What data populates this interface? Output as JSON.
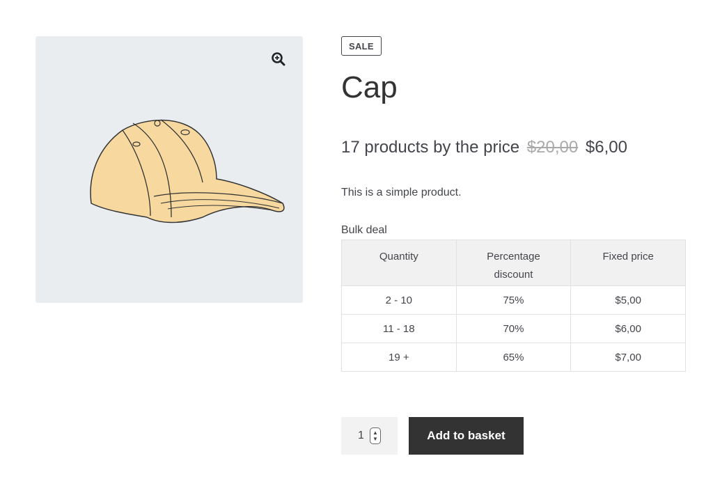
{
  "gallery": {
    "image_alt": "Cap",
    "zoom_icon": "zoom-in-icon"
  },
  "product": {
    "badge": "SALE",
    "title": "Cap",
    "price_prefix": "17 products by the price",
    "price_old": "$20,00",
    "price_new": "$6,00",
    "description": "This is a simple product."
  },
  "bulk": {
    "heading": "Bulk deal",
    "headers": [
      "Quantity",
      "Percentage discount",
      "Fixed price"
    ],
    "rows": [
      [
        "2 - 10",
        "75%",
        "$5,00"
      ],
      [
        "11 - 18",
        "70%",
        "$6,00"
      ],
      [
        "19 +",
        "65%",
        "$7,00"
      ]
    ]
  },
  "cart": {
    "quantity": "1",
    "add_label": "Add to basket"
  }
}
